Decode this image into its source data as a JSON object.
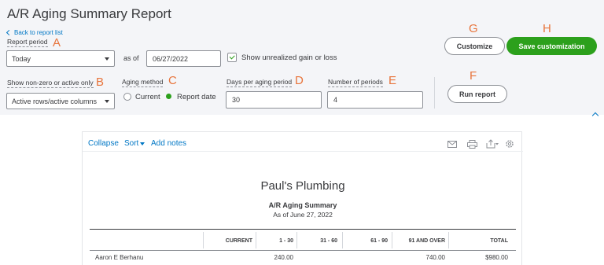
{
  "header": {
    "title": "A/R Aging Summary Report",
    "back_link": "Back to report list"
  },
  "filters": {
    "report_period_label": "Report period",
    "report_period_value": "Today",
    "as_of_label": "as of",
    "as_of_value": "06/27/2022",
    "unrealized_label": "Show unrealized gain or loss",
    "unrealized_checked": true,
    "nonzero_label": "Show non-zero or active only",
    "nonzero_value": "Active rows/active columns",
    "aging_method_label": "Aging method",
    "aging_current_label": "Current",
    "aging_report_date_label": "Report date",
    "aging_selected": "Report date",
    "days_label": "Days per aging period",
    "days_value": "30",
    "periods_label": "Number of periods",
    "periods_value": "4"
  },
  "buttons": {
    "customize": "Customize",
    "save_customization": "Save customization",
    "run_report": "Run report"
  },
  "callouts": {
    "a": "A",
    "b": "B",
    "c": "C",
    "d": "D",
    "e": "E",
    "f": "F",
    "g": "G",
    "h": "H"
  },
  "toolbar": {
    "collapse": "Collapse",
    "sort": "Sort",
    "add_notes": "Add notes",
    "icons": [
      "email-icon",
      "print-icon",
      "export-icon",
      "settings-icon"
    ]
  },
  "report": {
    "company": "Paul's Plumbing",
    "title": "A/R Aging Summary",
    "date": "As of June 27, 2022",
    "columns": [
      "CURRENT",
      "1 - 30",
      "31 - 60",
      "61 - 90",
      "91 AND OVER",
      "TOTAL"
    ],
    "rows": [
      {
        "name": "Aaron E Berhanu",
        "current": "",
        "d1_30": "240.00",
        "d31_60": "",
        "d61_90": "",
        "d91_over": "740.00",
        "total": "$980.00"
      }
    ]
  },
  "colors": {
    "accent_green": "#2ca01c",
    "link_blue": "#0077c5",
    "callout_orange": "#e8743b",
    "panel_bg": "#f4f5f8"
  }
}
